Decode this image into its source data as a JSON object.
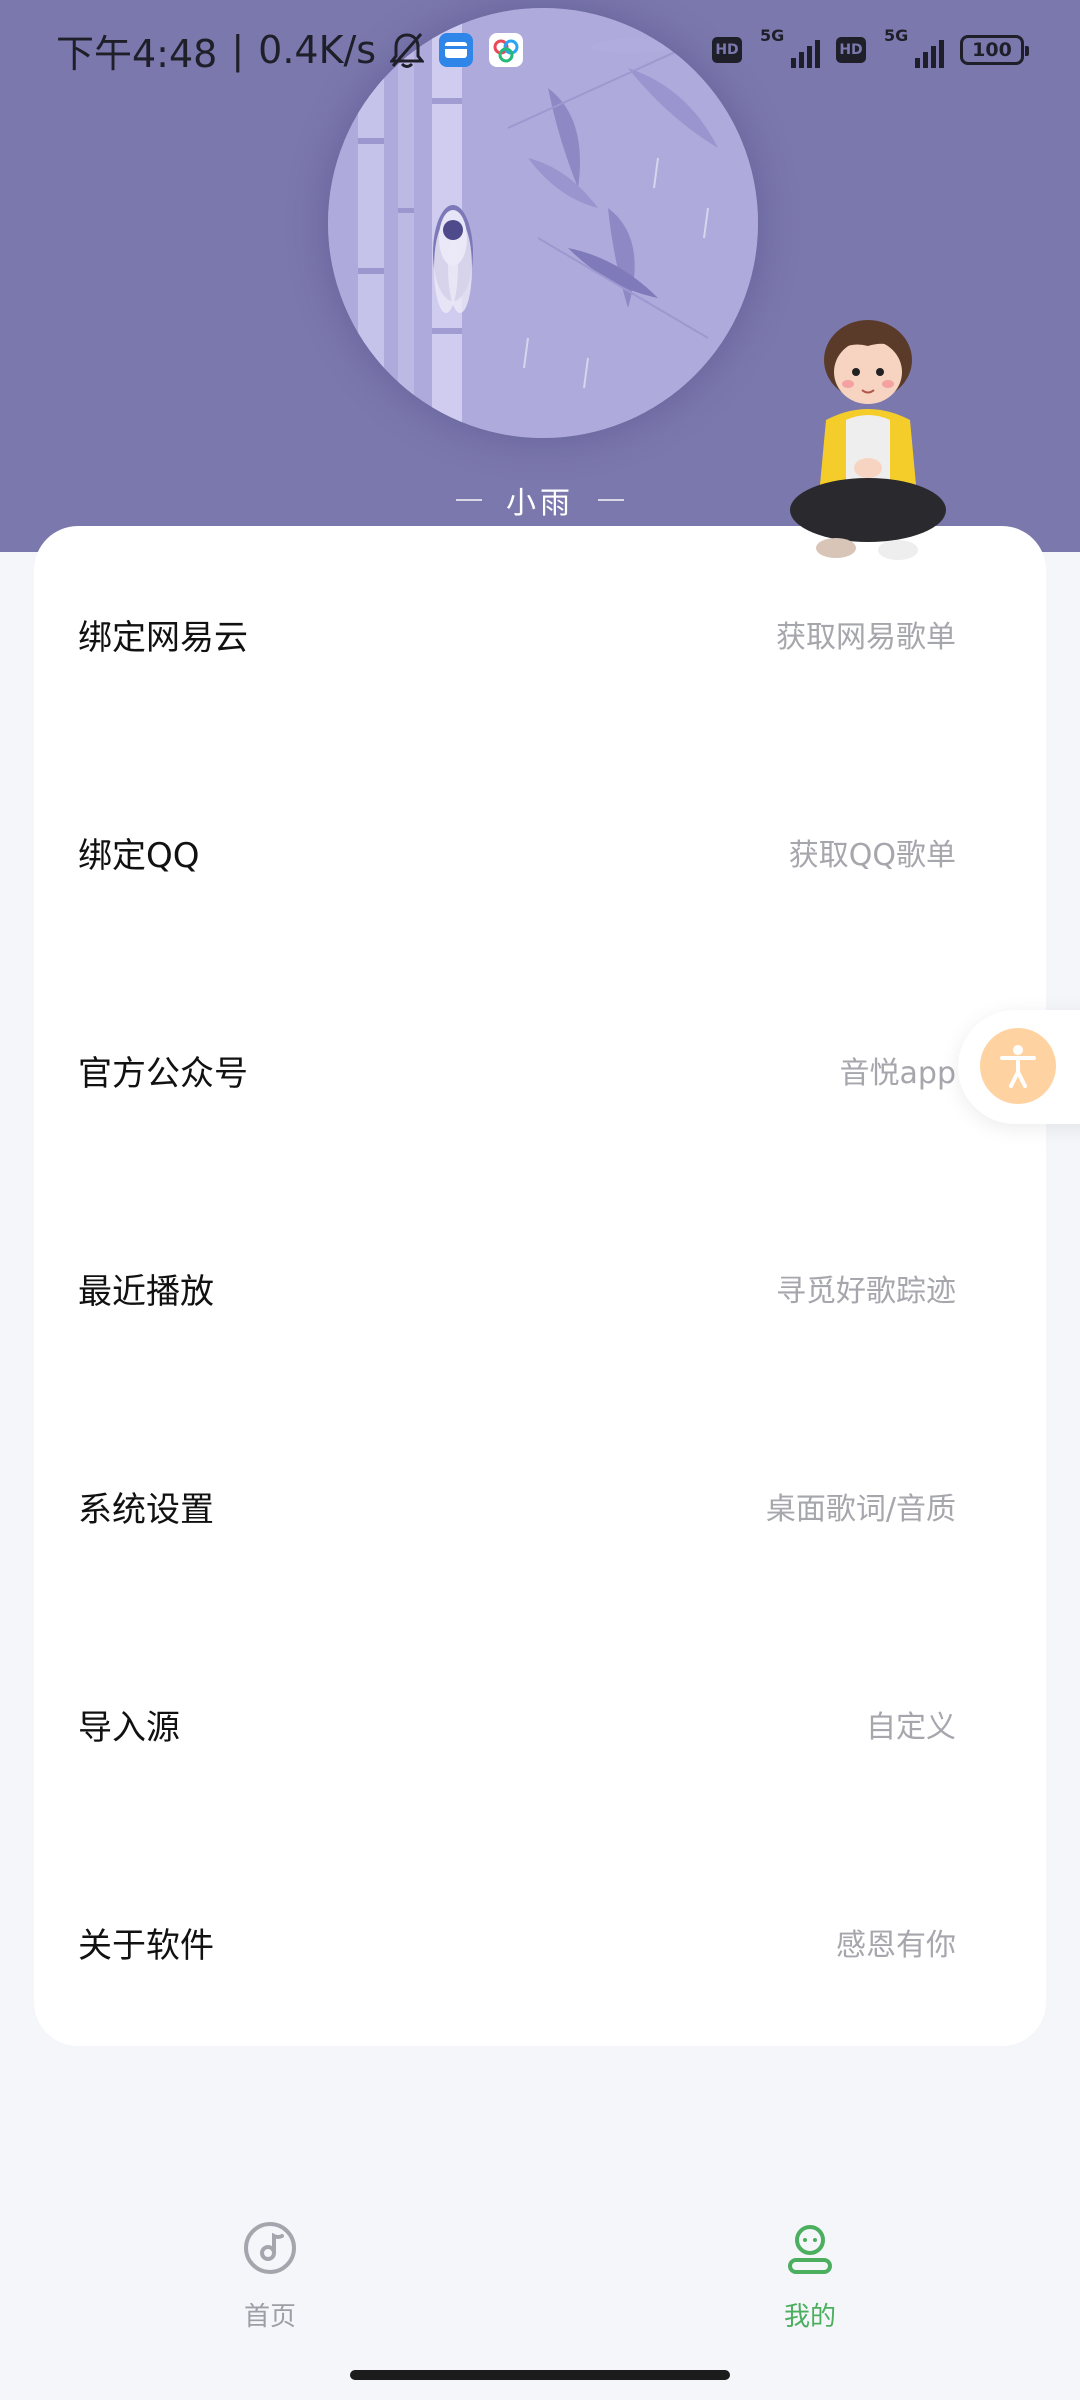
{
  "status_bar": {
    "time": "下午4:48",
    "network_speed": "0.4K/s",
    "separator": "|",
    "hd_label": "HD",
    "signal_label": "5G",
    "battery": "100"
  },
  "header": {
    "username": "小雨",
    "cover_icon": "bamboo-cicada-artwork",
    "background_color": "#7b78ad"
  },
  "menu": {
    "items": [
      {
        "title": "绑定网易云",
        "hint": "获取网易歌单"
      },
      {
        "title": "绑定QQ",
        "hint": "获取QQ歌单"
      },
      {
        "title": "官方公众号",
        "hint": "音悦app"
      },
      {
        "title": "最近播放",
        "hint": "寻觅好歌踪迹"
      },
      {
        "title": "系统设置",
        "hint": "桌面歌词/音质"
      },
      {
        "title": "导入源",
        "hint": "自定义"
      },
      {
        "title": "关于软件",
        "hint": "感恩有你"
      }
    ]
  },
  "floating_button": {
    "icon": "accessibility-icon",
    "color": "#ffd3a1"
  },
  "bottom_nav": {
    "items": [
      {
        "label": "首页",
        "icon": "music-disc-icon",
        "active": false
      },
      {
        "label": "我的",
        "icon": "profile-icon",
        "active": true
      }
    ],
    "active_color": "#4cae5f",
    "inactive_color": "#9e9ea6"
  }
}
